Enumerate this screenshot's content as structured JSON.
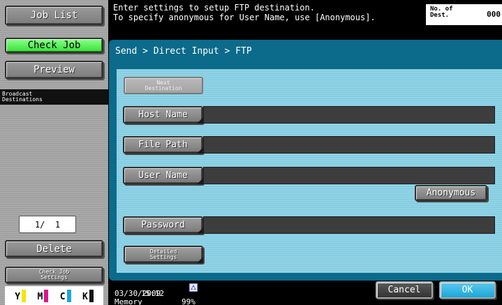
{
  "left_panel": {
    "job_list": "Job List",
    "check_job": "Check Job",
    "preview": "Preview",
    "broadcast": "Broadcast\nDestinations",
    "pager": "1/  1",
    "delete": "Delete",
    "check_job_settings": "Check Job\nSettings",
    "toner": [
      {
        "label": "Y",
        "color": "#f2e600"
      },
      {
        "label": "M",
        "color": "#e0148c"
      },
      {
        "label": "C",
        "color": "#1fa5e0"
      },
      {
        "label": "K",
        "color": "#111111"
      }
    ]
  },
  "header": {
    "line1": "Enter settings to setup FTP destination.",
    "line2": "To specify anonymous for User Name, use [Anonymous].",
    "dest_label": "No. of\nDest.",
    "dest_count": "000"
  },
  "main": {
    "breadcrumb": "Send > Direct Input > FTP",
    "next_destination": "Next\nDestination",
    "host_name": "Host Name",
    "file_path": "File Path",
    "user_name": "User Name",
    "anonymous": "Anonymous",
    "password": "Password",
    "detailed_settings": "Detailed\nSettings",
    "host_name_value": "",
    "file_path_value": "",
    "user_name_value": "",
    "password_value": ""
  },
  "footer": {
    "date": "03/30/2009",
    "time": "15:12",
    "memory_label": "Memory",
    "memory_value": "99%",
    "cancel": "Cancel",
    "ok": "OK"
  },
  "colors": {
    "accent_green": "#36e236",
    "panel_blue": "#0c6a8a",
    "inner_blue": "#8acfe2",
    "cancel": "#444444",
    "ok": "#1aa8d8"
  }
}
